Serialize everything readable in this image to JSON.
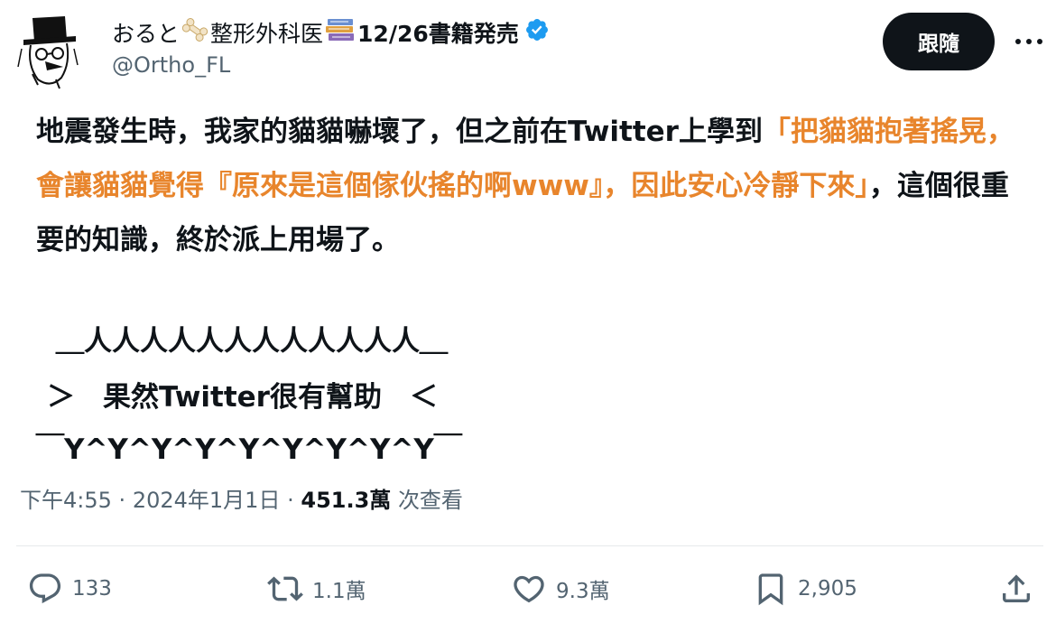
{
  "author": {
    "name_prefix": "おると",
    "name_mid": "整形外科医",
    "name_suffix": "12/26書籍発売",
    "handle": "@Ortho_FL"
  },
  "follow_label": "跟隨",
  "tweet": {
    "line1_a": "地震發生時，我家的貓貓嚇壞了，但之前在Twitter上學到",
    "line1_b": "「把貓貓抱著搖晃，會讓貓貓覺得『原來是這個傢伙搖的啊www』，因此安心冷靜下來」",
    "line1_c": "，這個很重要的知識，終於派上用場了。",
    "aa_top": "＿人人人人人人人人人人人人＿",
    "aa_mid": "＞　果然Twitter很有幫助　＜",
    "aa_bottom": "￣Y^Y^Y^Y^Y^Y^Y^Y^Y￣"
  },
  "meta": {
    "time": "下午4:55",
    "dot": "·",
    "date": "2024年1月1日",
    "views_count": "451.3萬",
    "views_label": "次查看"
  },
  "actions": {
    "replies": "133",
    "retweets": "1.1萬",
    "likes": "9.3萬",
    "bookmarks": "2,905"
  },
  "colors": {
    "accent_orange": "#e8852c",
    "verified_blue": "#1d9bf0",
    "muted": "#536471"
  }
}
